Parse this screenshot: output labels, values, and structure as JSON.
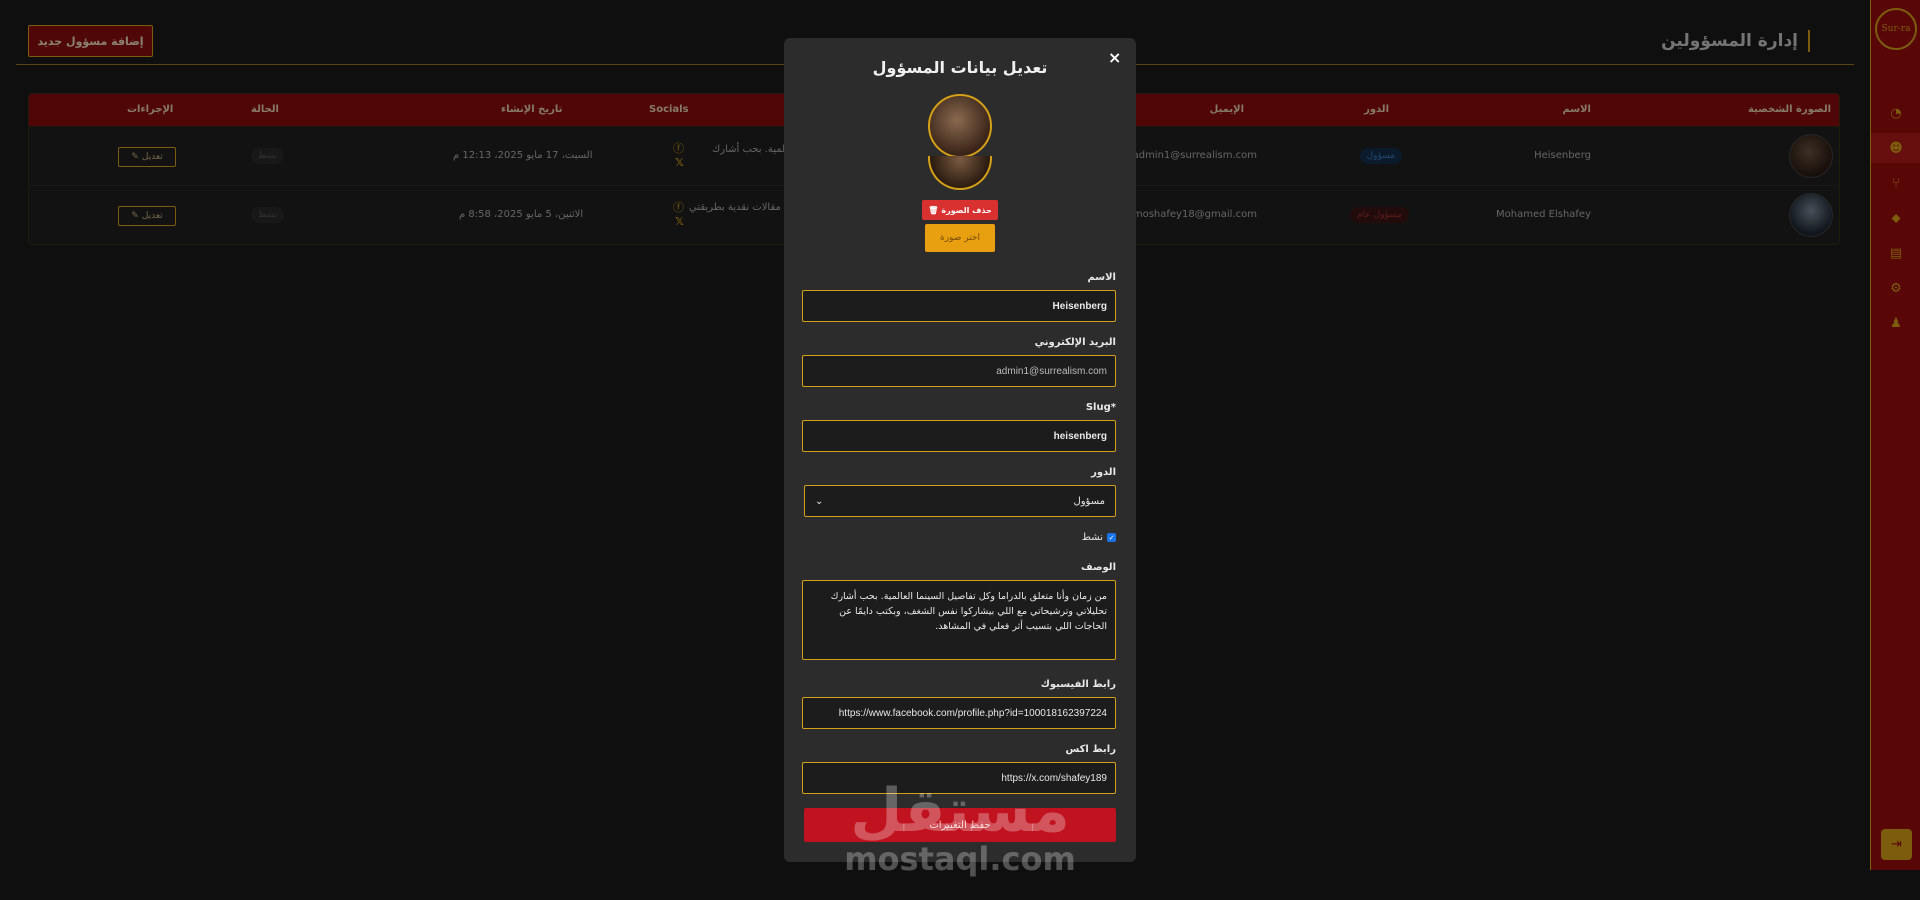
{
  "header": {
    "title": "إدارة المسؤولين",
    "add_button": "إضافة مسؤول جديد"
  },
  "table": {
    "headers": {
      "photo": "الصورة الشخصية",
      "name": "الاسم",
      "role": "الدور",
      "email": "الإيميل",
      "socials": "Socials",
      "created": "تاريخ الإنشاء",
      "status": "الحالة",
      "actions": "الإجراءات"
    },
    "rows": [
      {
        "name": "Heisenberg",
        "role": "مسؤول",
        "email": "admin1@surrealism.com",
        "bio_snippet": "لمية. بحب أشارك",
        "created": "السبت، 17 مايو 2025، 12:13 م",
        "status": "نشط",
        "edit": "تعديل"
      },
      {
        "name": "Mohamed Elshafey",
        "role": "مسؤول عام",
        "email": "moshafey18@gmail.com",
        "bio_snippet": "مقالات نقدية بطريقتي",
        "created": "الاثنين، 5 مايو 2025، 8:58 م",
        "status": "نشط",
        "edit": "تعديل"
      }
    ]
  },
  "sidebar": {
    "logo_text": "Sur-ra",
    "icons": [
      "dashboard-icon",
      "users-icon",
      "branch-icon",
      "tags-icon",
      "articles-icon",
      "settings-icon",
      "profile-icon"
    ],
    "active_index": 1
  },
  "modal": {
    "title": "تعديل بيانات المسؤول",
    "close": "×",
    "delete_photo": "حذف الصورة",
    "choose_photo": "اختر صورة",
    "fields": {
      "name_label": "الاسم",
      "name_value": "Heisenberg",
      "email_label": "البريد الإلكتروني",
      "email_value": "admin1@surrealism.com",
      "slug_label": "Slug*",
      "slug_value": "heisenberg",
      "role_label": "الدور",
      "role_value": "مسؤول",
      "active_label": "نشط",
      "desc_label": "الوصف",
      "desc_value": "من زمان وأنا متعلق بالدراما وكل تفاصيل السينما العالمية. بحب أشارك تحليلاتي وترشيحاتي مع اللي بيشاركوا نفس الشغف، وبكتب دايمًا عن الحاجات اللي بتسيب أثر فعلي في المشاهد.",
      "facebook_label": "رابط الفيسبوك",
      "facebook_value": "https://www.facebook.com/profile.php?id=100018162397224",
      "x_label": "رابط اكس",
      "x_value": "https://x.com/shafey189"
    },
    "save": "حفظ التغييرات"
  },
  "watermark": {
    "arabic": "مستقل",
    "latin": "mostaql.com"
  },
  "colors": {
    "primary_red": "#9a0c0c",
    "accent_gold": "#d4a017",
    "bg": "#1a1a1a"
  }
}
